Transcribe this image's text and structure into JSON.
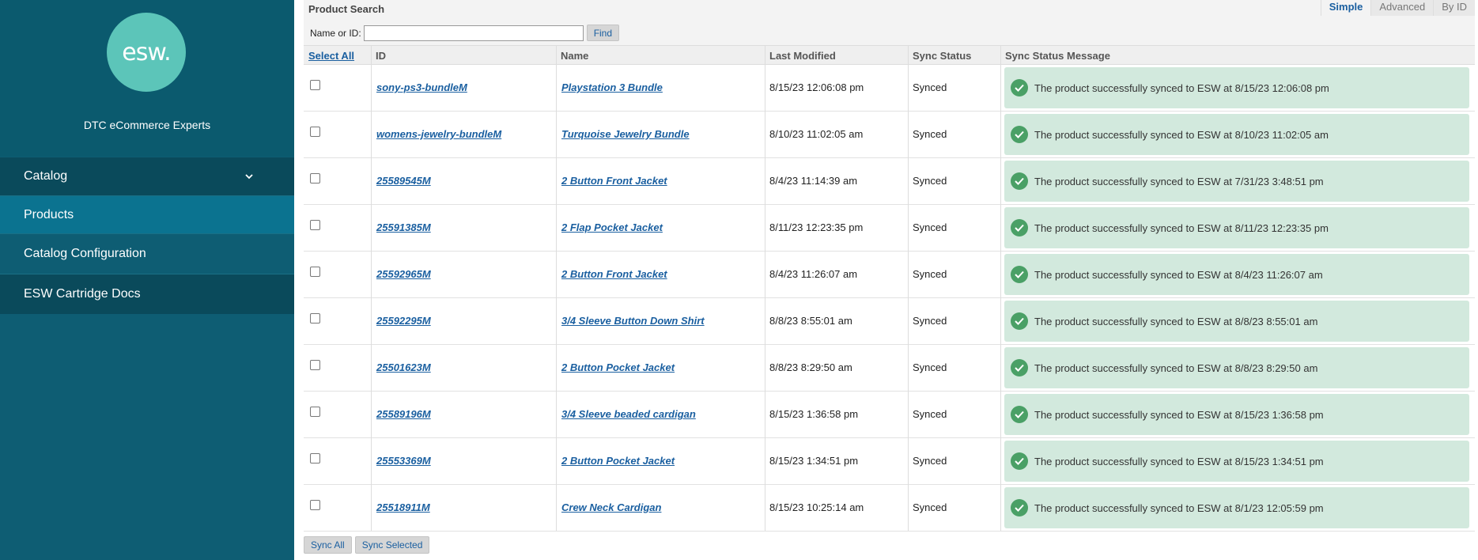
{
  "sidebar": {
    "logo_text": "esw.",
    "tagline": "DTC eCommerce Experts",
    "items": [
      {
        "label": "Catalog"
      },
      {
        "label": "Products"
      },
      {
        "label": "Catalog Configuration"
      },
      {
        "label": "ESW Cartridge Docs"
      }
    ]
  },
  "search": {
    "title": "Product Search",
    "tabs": [
      "Simple",
      "Advanced",
      "By ID"
    ],
    "label": "Name or ID:",
    "value": "",
    "find_label": "Find"
  },
  "table": {
    "select_all": "Select All",
    "headers": [
      "ID",
      "Name",
      "Last Modified",
      "Sync Status",
      "Sync Status Message"
    ],
    "rows": [
      {
        "id": "sony-ps3-bundleM",
        "name": "Playstation 3 Bundle",
        "modified": "8/15/23 12:06:08 pm",
        "status": "Synced",
        "message": "The product successfully synced to ESW at 8/15/23 12:06:08 pm"
      },
      {
        "id": "womens-jewelry-bundleM",
        "name": "Turquoise Jewelry Bundle",
        "modified": "8/10/23 11:02:05 am",
        "status": "Synced",
        "message": "The product successfully synced to ESW at 8/10/23 11:02:05 am"
      },
      {
        "id": "25589545M",
        "name": "2 Button Front Jacket",
        "modified": "8/4/23 11:14:39 am",
        "status": "Synced",
        "message": "The product successfully synced to ESW at 7/31/23 3:48:51 pm"
      },
      {
        "id": "25591385M",
        "name": "2 Flap Pocket Jacket",
        "modified": "8/11/23 12:23:35 pm",
        "status": "Synced",
        "message": "The product successfully synced to ESW at 8/11/23 12:23:35 pm"
      },
      {
        "id": "25592965M",
        "name": "2 Button Front Jacket",
        "modified": "8/4/23 11:26:07 am",
        "status": "Synced",
        "message": "The product successfully synced to ESW at 8/4/23 11:26:07 am"
      },
      {
        "id": "25592295M",
        "name": "3/4 Sleeve Button Down Shirt",
        "modified": "8/8/23 8:55:01 am",
        "status": "Synced",
        "message": "The product successfully synced to ESW at 8/8/23 8:55:01 am"
      },
      {
        "id": "25501623M",
        "name": "2 Button Pocket Jacket",
        "modified": "8/8/23 8:29:50 am",
        "status": "Synced",
        "message": "The product successfully synced to ESW at 8/8/23 8:29:50 am"
      },
      {
        "id": "25589196M",
        "name": "3/4 Sleeve beaded cardigan",
        "modified": "8/15/23 1:36:58 pm",
        "status": "Synced",
        "message": "The product successfully synced to ESW at 8/15/23 1:36:58 pm"
      },
      {
        "id": "25553369M",
        "name": "2 Button Pocket Jacket",
        "modified": "8/15/23 1:34:51 pm",
        "status": "Synced",
        "message": "The product successfully synced to ESW at 8/15/23 1:34:51 pm"
      },
      {
        "id": "25518911M",
        "name": "Crew Neck Cardigan",
        "modified": "8/15/23 10:25:14 am",
        "status": "Synced",
        "message": "The product successfully synced to ESW at 8/1/23 12:05:59 pm"
      }
    ]
  },
  "footer": {
    "sync_all": "Sync All",
    "sync_selected": "Sync Selected"
  },
  "colors": {
    "sidebar_bg": "#0e5d73",
    "active_item": "#0b7390",
    "logo": "#5cc5b9",
    "link": "#1a5fa0",
    "success_bg": "#d2e9dd",
    "success_icon": "#4aa066"
  },
  "icons": [
    "chevron-down-icon",
    "check-circle-icon"
  ]
}
